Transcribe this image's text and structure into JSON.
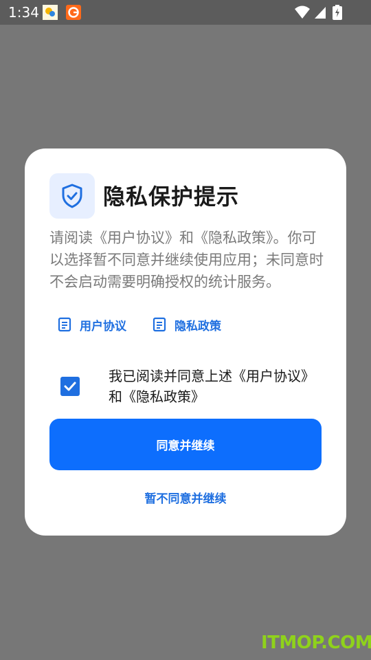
{
  "status_bar": {
    "time": "1:34"
  },
  "dialog": {
    "title": "隐私保护提示",
    "body": "请阅读《用户协议》和《隐私政策》。你可以选择暂不同意并继续使用应用；未同意时不会启动需要明确授权的统计服务。",
    "links": [
      {
        "label": "用户协议"
      },
      {
        "label": "隐私政策"
      }
    ],
    "agree": {
      "checked": true,
      "text": "我已阅读并同意上述《用户协议》和《隐私政策》"
    },
    "primary_button": "同意并继续",
    "secondary_link": "暂不同意并继续"
  },
  "watermark": "ITMOP.COM",
  "colors": {
    "accent": "#0d6efd",
    "link": "#1f6fe0",
    "overlay": "#777777",
    "status_bar": "#5c5c5c"
  }
}
